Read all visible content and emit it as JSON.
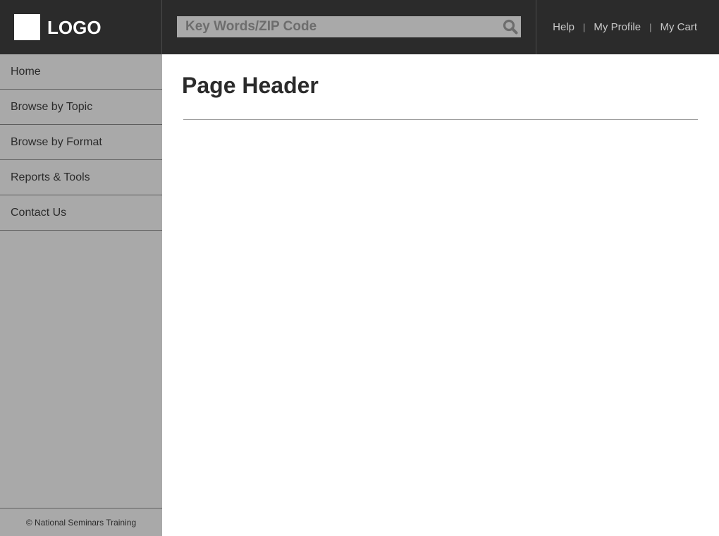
{
  "header": {
    "logo_text": "LOGO",
    "search": {
      "placeholder": "Key Words/ZIP Code",
      "icon": "search-icon"
    },
    "links": [
      {
        "label": "Help"
      },
      {
        "label": "My Profile"
      },
      {
        "label": "My Cart"
      }
    ],
    "separator": "|"
  },
  "sidebar": {
    "items": [
      {
        "label": "Home"
      },
      {
        "label": "Browse by Topic"
      },
      {
        "label": "Browse by Format"
      },
      {
        "label": "Reports & Tools"
      },
      {
        "label": "Contact Us"
      }
    ],
    "footer": "© National Seminars Training"
  },
  "main": {
    "page_title": "Page Header"
  },
  "colors": {
    "topbar_bg": "#2b2b2b",
    "sidebar_bg": "#a9a9a9",
    "search_bg": "#a9a9a9",
    "text_dark": "#2b2b2b",
    "link_light": "#c8c8c8"
  }
}
